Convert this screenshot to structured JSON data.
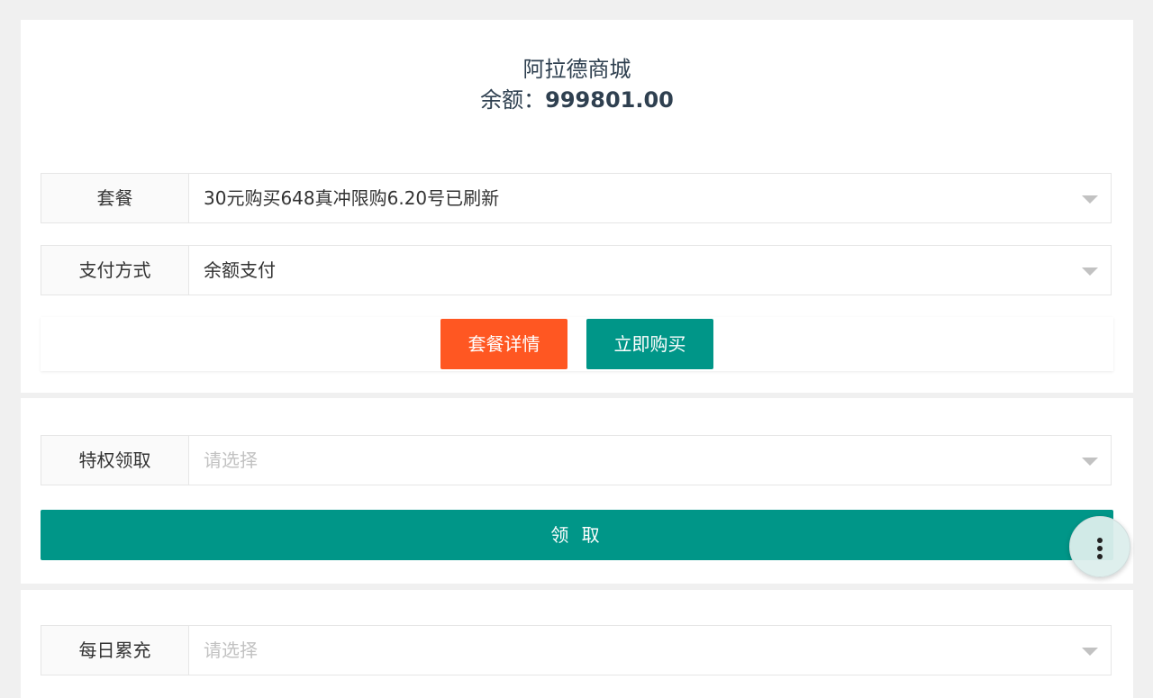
{
  "header": {
    "shop_name": "阿拉德商城",
    "balance_label": "余额：",
    "balance_value": "999801.00"
  },
  "purchase": {
    "package_label": "套餐",
    "package_value": "30元购买648真冲限购6.20号已刷新",
    "payment_label": "支付方式",
    "payment_value": "余额支付",
    "details_button": "套餐详情",
    "buy_button": "立即购买"
  },
  "privilege": {
    "label": "特权领取",
    "placeholder": "请选择",
    "claim_button": "领 取"
  },
  "daily": {
    "label": "每日累充",
    "placeholder": "请选择"
  },
  "colors": {
    "accent_green": "#009688",
    "accent_orange": "#ff5722",
    "text_dark": "#2f4050"
  },
  "fab": {
    "icon": "more-vertical-icon"
  }
}
